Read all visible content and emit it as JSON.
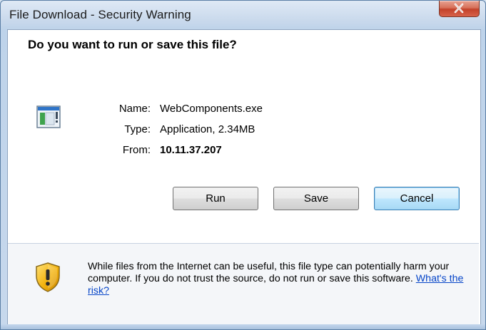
{
  "window": {
    "title": "File Download - Security Warning"
  },
  "dialog": {
    "question": "Do you want to run or save this file?",
    "file": {
      "name_label": "Name:",
      "name_value": "WebComponents.exe",
      "type_label": "Type:",
      "type_value": "Application, 2.34MB",
      "from_label": "From:",
      "from_value": "10.11.37.207"
    },
    "buttons": {
      "run": "Run",
      "save": "Save",
      "cancel": "Cancel"
    },
    "warning": {
      "text": "While files from the Internet can be useful, this file type can potentially harm your computer. If you do not trust the source, do not run or save this software.",
      "link": "What's the risk?"
    }
  },
  "icons": {
    "close": "close-icon",
    "file": "application-file-icon",
    "warning": "security-shield-icon"
  },
  "colors": {
    "link": "#0645c8",
    "close_button": "#c3422a",
    "shield": "#f2b20d"
  }
}
